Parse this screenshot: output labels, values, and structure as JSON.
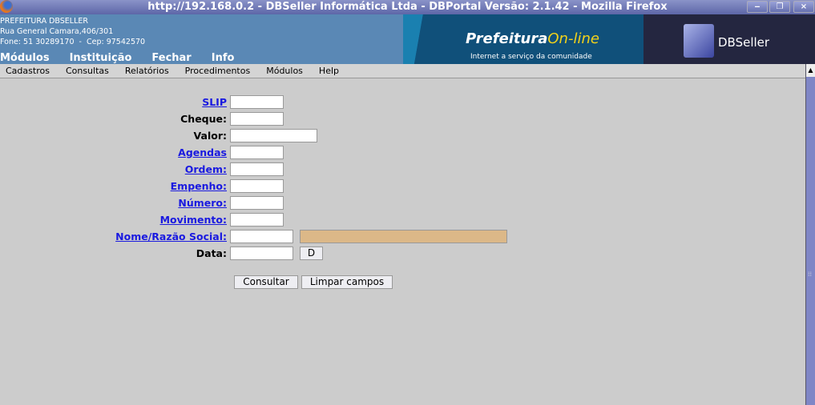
{
  "window": {
    "title": "http://192.168.0.2 - DBSeller Informática Ltda - DBPortal Versão: 2.1.42 - Mozilla Firefox",
    "minimize": "‒",
    "restore": "❐",
    "close": "×"
  },
  "header": {
    "org": "PREFEITURA DBSELLER",
    "address": "Rua General Camara,406/301",
    "contact": "Fone: 51 30289170  -  Cep: 97542570",
    "banner_main": "Prefeitura",
    "banner_accent": "On-line",
    "banner_sub": "Internet a serviço da comunidade",
    "dbseller": "DBSeller",
    "top_menu": [
      "Módulos",
      "Instituição",
      "Fechar",
      "Info"
    ]
  },
  "menubar": [
    "Cadastros",
    "Consultas",
    "Relatórios",
    "Procedimentos",
    "Módulos",
    "Help"
  ],
  "form": {
    "slip": "SLIP",
    "cheque": "Cheque:",
    "valor": "Valor:",
    "agendas": "Agendas",
    "ordem": "Ordem:",
    "empenho": "Empenho:",
    "numero": "Número:",
    "movimento": "Movimento:",
    "nome": "Nome/Razão Social:",
    "data": "Data:",
    "date_button": "D",
    "consultar": "Consultar",
    "limpar": "Limpar campos"
  },
  "colors": {
    "link": "#1a1ae0",
    "readonly_field": "#dcb888"
  }
}
